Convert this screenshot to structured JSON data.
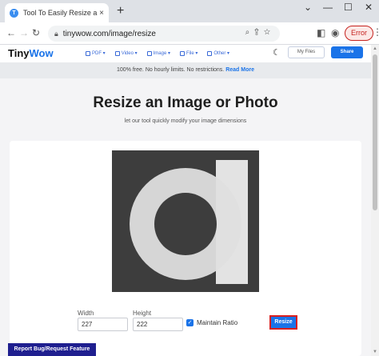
{
  "browser": {
    "tab_title": "Tool To Easily Resize an Image fo",
    "tab_favicon": "T",
    "tab_close": "×",
    "new_tab": "+",
    "window_controls": {
      "chevron": "⌄",
      "minimize": "—",
      "maximize": "☐",
      "close": "✕"
    },
    "url": "tinywow.com/image/resize",
    "error_label": "Error"
  },
  "site": {
    "brand_part1": "Tiny",
    "brand_part2": "Wow",
    "nav": [
      {
        "label": "PDF",
        "icon": "pdf-icon"
      },
      {
        "label": "Video",
        "icon": "video-icon"
      },
      {
        "label": "Image",
        "icon": "image-icon"
      },
      {
        "label": "File",
        "icon": "file-icon"
      },
      {
        "label": "Other",
        "icon": "other-icon"
      }
    ],
    "my_files_label": "My Files",
    "share_label": "Share"
  },
  "banner": {
    "text": "100% free. No hourly limits. No restrictions.",
    "link": "Read More"
  },
  "main": {
    "title": "Resize an Image or Photo",
    "subtitle": "let our tool quickly modify your image dimensions",
    "width_label": "Width",
    "width_value": "227",
    "height_label": "Height",
    "height_value": "222",
    "maintain_ratio_label": "Maintain Ratio",
    "maintain_ratio_checked": true,
    "resize_label": "Resize",
    "report_label": "Report Bug/Request Feature"
  },
  "colors": {
    "accent": "#1a73e8",
    "highlight": "#d91e1e",
    "preview_bg": "#3d3d3d"
  }
}
